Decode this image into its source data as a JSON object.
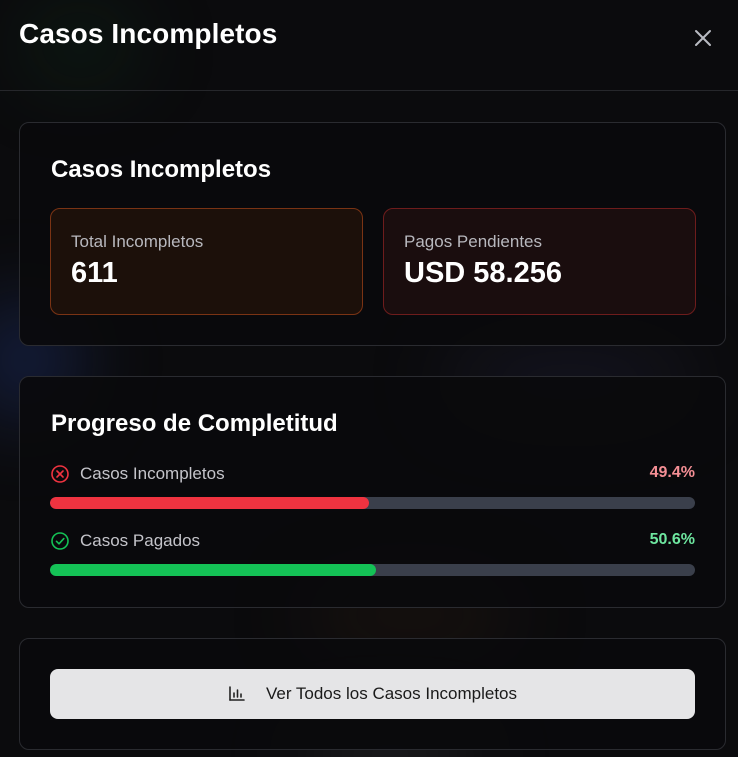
{
  "modal": {
    "title": "Casos Incompletos",
    "close_icon": "close-icon"
  },
  "summary": {
    "heading": "Casos Incompletos",
    "total": {
      "label": "Total Incompletos",
      "value": "611",
      "accent": "#7a3314"
    },
    "pending": {
      "label": "Pagos Pendientes",
      "value": "USD 58.256",
      "accent": "#6e1c1c"
    }
  },
  "progress": {
    "heading": "Progreso de Completitud",
    "rows": [
      {
        "label": "Casos Incompletos",
        "percent_text": "49.4%",
        "fraction": 0.494,
        "icon": "x-circle-icon",
        "color": "#ef3340",
        "text_color": "#f58f95"
      },
      {
        "label": "Casos Pagados",
        "percent_text": "50.6%",
        "fraction": 0.506,
        "icon": "check-circle-icon",
        "color": "#14c256",
        "text_color": "#6ee7a0"
      }
    ]
  },
  "action": {
    "label": "Ver Todos los Casos Incompletos",
    "icon": "bar-chart-icon"
  },
  "colors": {
    "background": "#0b0b0d",
    "card_border": "#2a2b30",
    "track": "#3a3f4b",
    "button_bg": "#e5e5e7"
  }
}
